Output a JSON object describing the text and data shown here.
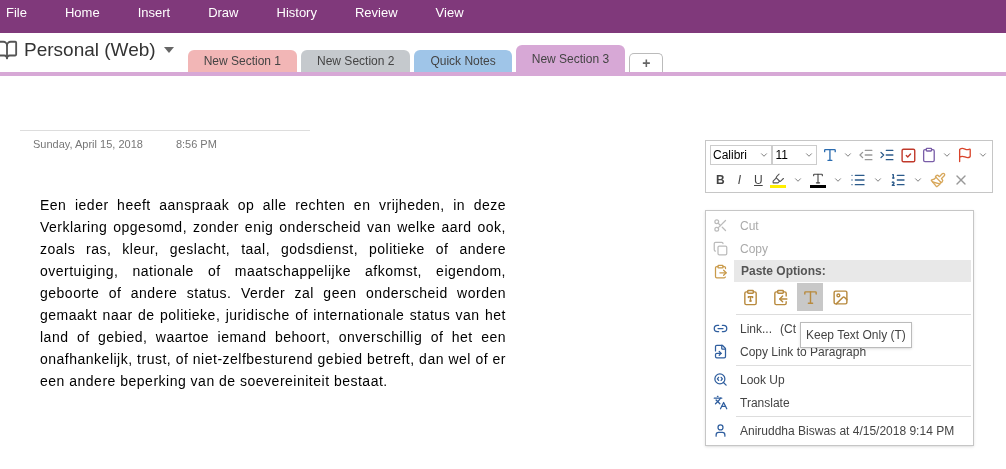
{
  "menu_bar": [
    "File",
    "Home",
    "Insert",
    "Draw",
    "History",
    "Review",
    "View"
  ],
  "notebook": {
    "title": "Personal (Web)"
  },
  "sections": [
    {
      "label": "New Section 1",
      "color": "#f2b6b6",
      "selected": false
    },
    {
      "label": "New Section 2",
      "color": "#c5c9cd",
      "selected": false
    },
    {
      "label": "Quick Notes",
      "color": "#9fc5e8",
      "selected": false
    },
    {
      "label": "New Section 3",
      "color": "#d7a8d6",
      "selected": true
    }
  ],
  "add_section": "+",
  "page": {
    "date": "Sunday, April 15, 2018",
    "time": "8:56 PM",
    "body": "Een ieder heeft aanspraak op alle rechten en vrijheden, in deze Verklaring opgesomd, zonder enig onderscheid van welke aard ook, zoals ras, kleur, geslacht, taal, godsdienst, politieke of andere overtuiging, nationale of maatschappelijke afkomst, eigendom, geboorte of andere status. Verder zal geen onderscheid worden gemaakt naar de politieke, juridische of internationale status van het land of gebied, waartoe iemand behoort, onverschillig of het een onafhankelijk, trust, of niet-zelfbesturend gebied betreft, dan wel of er een andere beperking van de soevereiniteit bestaat."
  },
  "mini_toolbar": {
    "font": "Calibri",
    "size": "11",
    "bold": "B",
    "italic": "I",
    "underline": "U"
  },
  "context_menu": [
    {
      "kind": "item",
      "label": "Cut",
      "disabled": true
    },
    {
      "kind": "item",
      "label": "Copy",
      "disabled": true
    },
    {
      "kind": "header",
      "label": "Paste Options:"
    },
    {
      "kind": "paste",
      "options": [
        {
          "selected": false
        },
        {
          "selected": false
        },
        {
          "selected": true
        },
        {
          "selected": false
        }
      ]
    },
    {
      "kind": "separator"
    },
    {
      "kind": "item",
      "label": "Link...",
      "shortcut": "(Ct",
      "disabled": false
    },
    {
      "kind": "item",
      "label": "Copy Link to Paragraph",
      "disabled": false
    },
    {
      "kind": "separator"
    },
    {
      "kind": "item",
      "label": "Look Up",
      "disabled": false
    },
    {
      "kind": "item",
      "label": "Translate",
      "disabled": false
    },
    {
      "kind": "separator"
    },
    {
      "kind": "item",
      "label": "Aniruddha Biswas at 4/15/2018 9:14 PM",
      "disabled": false
    }
  ],
  "tooltip": "Keep Text Only (T)"
}
